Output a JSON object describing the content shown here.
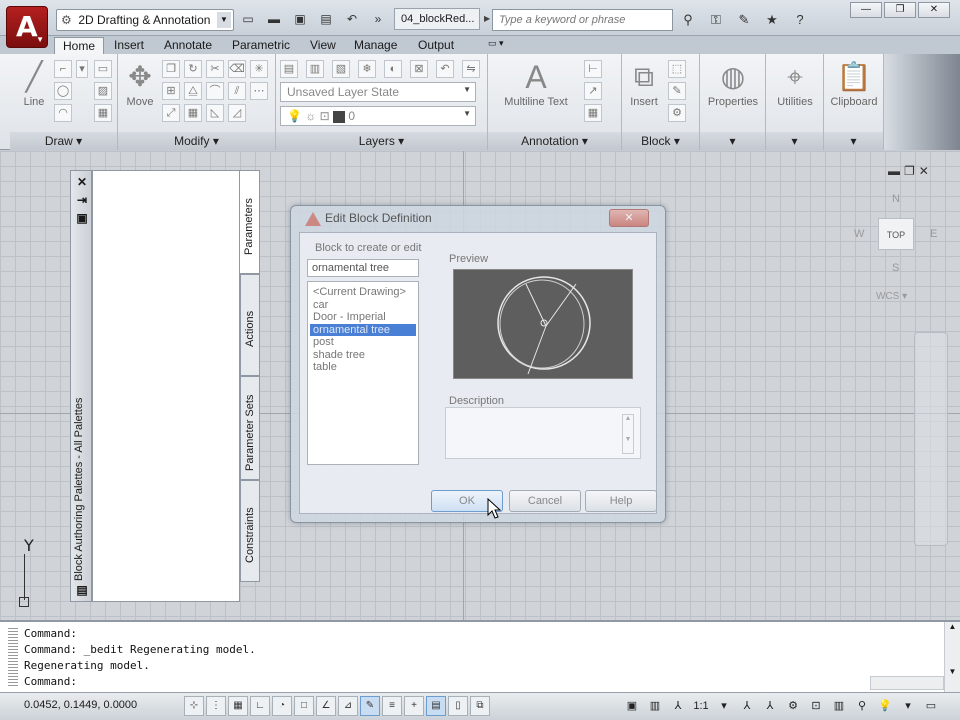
{
  "titlebar": {
    "workspace": "2D Drafting & Annotation",
    "doc_tab": "04_blockRed...",
    "search_placeholder": "Type a keyword or phrase"
  },
  "ribbon_tabs": [
    "Home",
    "Insert",
    "Annotate",
    "Parametric",
    "View",
    "Manage",
    "Output"
  ],
  "ribbon": {
    "draw": {
      "title": "Draw",
      "line_label": "Line"
    },
    "modify": {
      "title": "Modify",
      "move_label": "Move"
    },
    "layers": {
      "title": "Layers",
      "layer_state": "Unsaved Layer State",
      "current_layer": "0"
    },
    "annotation": {
      "title": "Annotation",
      "multiline_label": "Multiline Text"
    },
    "block": {
      "title": "Block",
      "insert_label": "Insert"
    },
    "properties_label": "Properties",
    "utilities_label": "Utilities",
    "clipboard_label": "Clipboard"
  },
  "palette": {
    "title": "Block Authoring Palettes - All Palettes",
    "tabs": [
      "Parameters",
      "Actions",
      "Parameter Sets",
      "Constraints"
    ]
  },
  "viewcube": {
    "top": "TOP",
    "north": "N",
    "south": "S",
    "east": "E",
    "west": "W",
    "wcs": "WCS"
  },
  "ucs": {
    "y_label": "Y"
  },
  "dialog": {
    "title": "Edit Block Definition",
    "block_label": "Block to create or edit",
    "block_value": "ornamental tree",
    "blocks": [
      "<Current Drawing>",
      "car",
      "Door - Imperial",
      "ornamental tree",
      "post",
      "shade tree",
      "table"
    ],
    "selected_index": 3,
    "preview_label": "Preview",
    "description_label": "Description",
    "ok": "OK",
    "cancel": "Cancel",
    "help": "Help"
  },
  "command": {
    "lines": [
      "Command:",
      "Command:  _bedit Regenerating model.",
      "Regenerating model."
    ],
    "prompt": "Command:"
  },
  "status": {
    "coords": "0.0452, 0.1449, 0.0000",
    "annotation_scale": "1:1"
  },
  "colors": {
    "accent": "#4a7fd6",
    "app_button": "#a01a1a"
  }
}
